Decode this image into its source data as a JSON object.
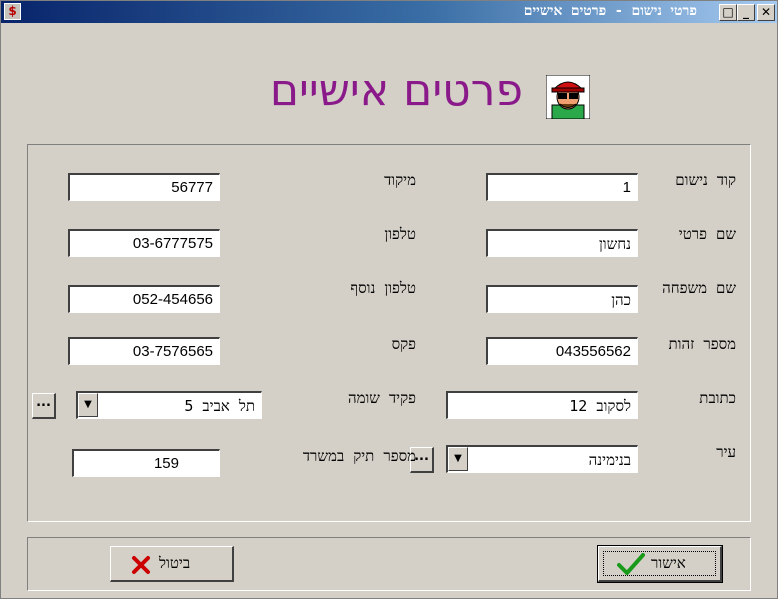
{
  "window": {
    "title": "פרטי נישום - פרטים אישיים"
  },
  "heading": {
    "text": "פרטים אישיים"
  },
  "form": {
    "right": [
      {
        "label": "קוד נישום",
        "value": "1"
      },
      {
        "label": "שם פרטי",
        "value": "נחשון"
      },
      {
        "label": "שם משפחה",
        "value": "כהן"
      },
      {
        "label": "מספר זהות",
        "value": "043556562"
      },
      {
        "label": "כתובת",
        "value": "לסקוב 12"
      },
      {
        "label": "עיר",
        "value": "בנימינה"
      }
    ],
    "left": [
      {
        "label": "מיקוד",
        "value": "56777"
      },
      {
        "label": "טלפון",
        "value": "03-6777575"
      },
      {
        "label": "טלפון נוסף",
        "value": "052-454656"
      },
      {
        "label": "פקס",
        "value": "03-7576565"
      },
      {
        "label": "פקיד שומה",
        "value": "תל אביב 5"
      },
      {
        "label": "מספר תיק במשרד",
        "value": "159"
      }
    ]
  },
  "buttons": {
    "ok_label": "אישור",
    "cancel_label": "ביטול",
    "browse_label": "..."
  },
  "icons": {
    "dropdown": "▼",
    "minimize": "_",
    "maximize": "□",
    "close": "✕"
  },
  "colors": {
    "heading": "#8a1a8a",
    "title_bar": "#08246b",
    "ok_check": "#1a9a1a",
    "cancel_x": "#cc0000"
  }
}
